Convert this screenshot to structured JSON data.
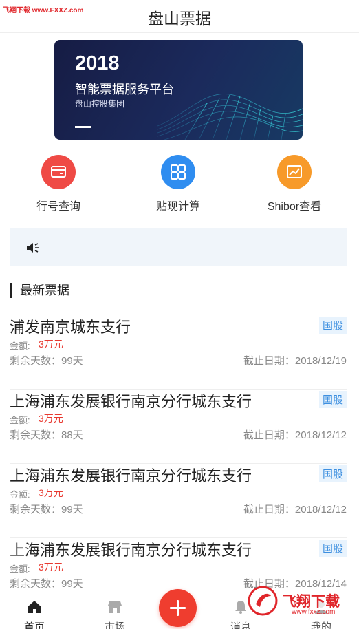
{
  "watermark_top": "飞翔下载 www.FXXZ.com",
  "header": {
    "title": "盘山票据"
  },
  "banner": {
    "year": "2018",
    "title": "智能票据服务平台",
    "subtitle": "盘山控股集团"
  },
  "quick_actions": [
    {
      "label": "行号查询",
      "icon": "card-icon",
      "color": "#ef4a45"
    },
    {
      "label": "贴现计算",
      "icon": "calculator-icon",
      "color": "#2f8df0"
    },
    {
      "label": "Shibor查看",
      "icon": "chart-icon",
      "color": "#f79a2a"
    }
  ],
  "notice": {
    "icon": "speaker-icon",
    "text": ""
  },
  "section": {
    "title": "最新票据"
  },
  "bills": [
    {
      "bank": "浦发南京城东支行",
      "tag": "国股",
      "amount_label": "金额:",
      "amount": "3万元",
      "days": "剩余天数：99天",
      "deadline": "截止日期：2018/12/19"
    },
    {
      "bank": "上海浦东发展银行南京分行城东支行",
      "tag": "国股",
      "amount_label": "金额:",
      "amount": "3万元",
      "days": "剩余天数：88天",
      "deadline": "截止日期：2018/12/12"
    },
    {
      "bank": "上海浦东发展银行南京分行城东支行",
      "tag": "国股",
      "amount_label": "金额:",
      "amount": "3万元",
      "days": "剩余天数：99天",
      "deadline": "截止日期：2018/12/12"
    },
    {
      "bank": "上海浦东发展银行南京分行城东支行",
      "tag": "国股",
      "amount_label": "金额:",
      "amount": "3万元",
      "days": "剩余天数：99天",
      "deadline": "截止日期：2018/12/14"
    }
  ],
  "tabbar": {
    "home": "首页",
    "market": "市场",
    "messages": "消息",
    "mine": "我的"
  },
  "watermark_bottom": {
    "brand": "飞翔下载",
    "url": "www.fxxz.com"
  }
}
